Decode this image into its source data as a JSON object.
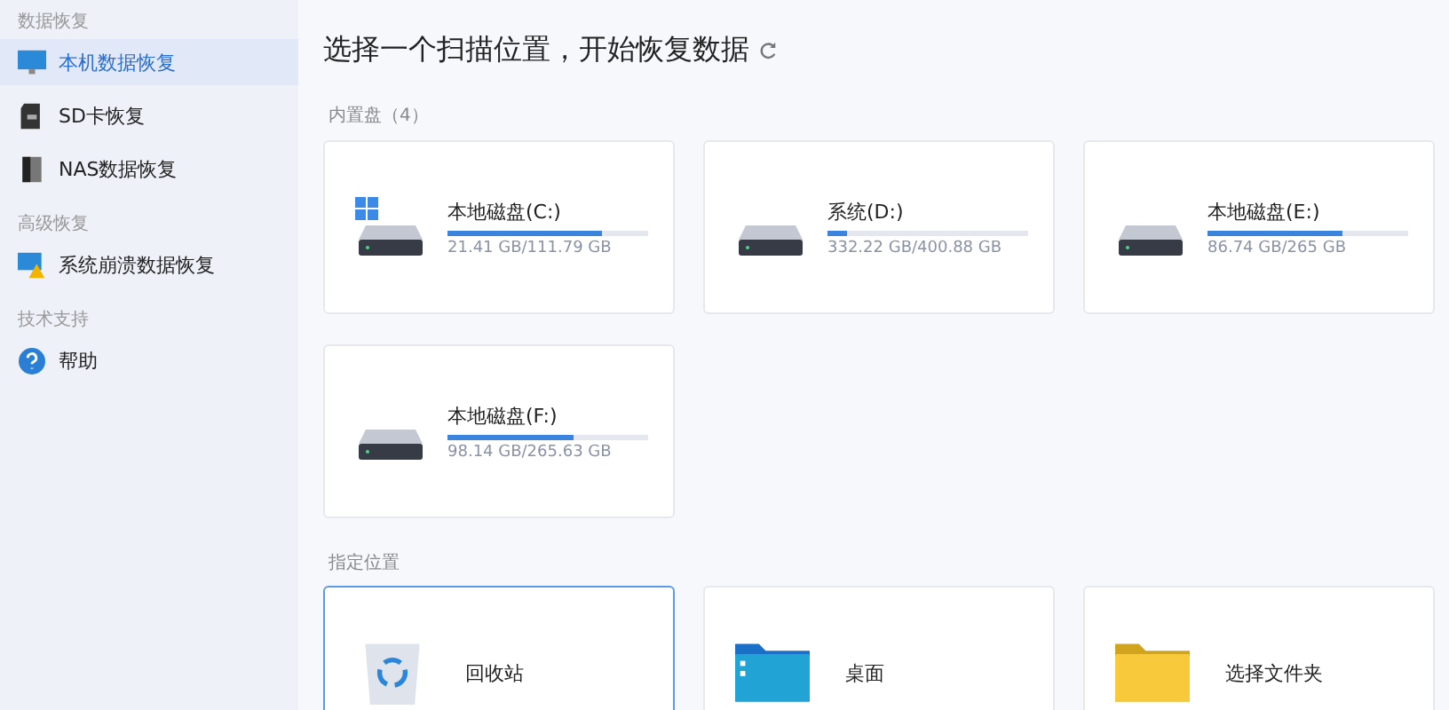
{
  "sidebar": {
    "sections": [
      {
        "label": "数据恢复",
        "items": [
          {
            "label": "本机数据恢复",
            "kind": "monitor",
            "selected": true
          },
          {
            "label": "SD卡恢复",
            "kind": "sdcard",
            "selected": false
          },
          {
            "label": "NAS数据恢复",
            "kind": "nas",
            "selected": false
          }
        ]
      },
      {
        "label": "高级恢复",
        "items": [
          {
            "label": "系统崩溃数据恢复",
            "kind": "crash",
            "selected": false
          }
        ]
      },
      {
        "label": "技术支持",
        "items": [
          {
            "label": "帮助",
            "kind": "help",
            "selected": false
          }
        ]
      }
    ]
  },
  "main": {
    "title": "选择一个扫描位置，开始恢复数据",
    "drives_label": "内置盘（4）",
    "drives": [
      {
        "name": "本地磁盘(C:)",
        "usage": "21.41 GB/111.79 GB",
        "level": 0.77,
        "kind": "windows"
      },
      {
        "name": "系统(D:)",
        "usage": "332.22 GB/400.88 GB",
        "level": 0.1,
        "kind": "disk"
      },
      {
        "name": "本地磁盘(E:)",
        "usage": "86.74 GB/265 GB",
        "level": 0.67,
        "kind": "disk"
      },
      {
        "name": "本地磁盘(F:)",
        "usage": "98.14 GB/265.63 GB",
        "level": 0.63,
        "kind": "disk"
      }
    ],
    "locations_label": "指定位置",
    "locations": [
      {
        "name": "回收站",
        "kind": "recycle",
        "selected": true
      },
      {
        "name": "桌面",
        "kind": "desktop",
        "selected": false
      },
      {
        "name": "选择文件夹",
        "kind": "folder",
        "selected": false
      }
    ]
  }
}
